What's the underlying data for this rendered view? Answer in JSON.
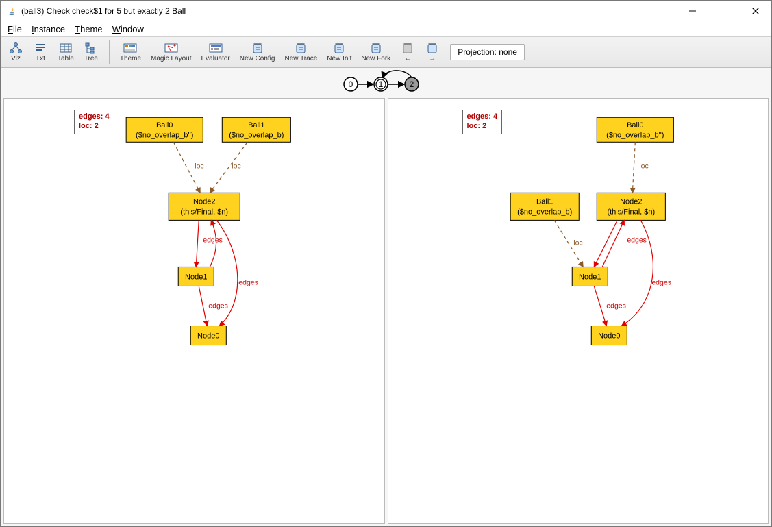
{
  "window": {
    "title": "(ball3) Check check$1 for 5 but exactly 2 Ball"
  },
  "menu": {
    "file": "File",
    "instance": "Instance",
    "theme": "Theme",
    "window": "Window"
  },
  "toolbar": {
    "viz": "Viz",
    "txt": "Txt",
    "table": "Table",
    "tree": "Tree",
    "theme": "Theme",
    "magic_layout": "Magic Layout",
    "evaluator": "Evaluator",
    "new_config": "New Config",
    "new_trace": "New Trace",
    "new_init": "New Init",
    "new_fork": "New Fork",
    "prev": "←",
    "next": "→",
    "projection": "Projection: none"
  },
  "trace": {
    "steps": [
      "0",
      "1",
      "2"
    ],
    "active_index": 1,
    "loop_from_index": 2,
    "loop_to_index": 1
  },
  "panels": [
    {
      "info": {
        "edges": "edges: 4",
        "loc": "loc: 2"
      },
      "nodes": {
        "ball0": {
          "line1": "Ball0",
          "line2": "($no_overlap_b'')"
        },
        "ball1": {
          "line1": "Ball1",
          "line2": "($no_overlap_b)"
        },
        "node2": {
          "line1": "Node2",
          "line2": "(this/Final, $n)"
        },
        "node1": {
          "line1": "Node1"
        },
        "node0": {
          "line1": "Node0"
        }
      },
      "edge_labels": {
        "loc": "loc",
        "edges": "edges"
      }
    },
    {
      "info": {
        "edges": "edges: 4",
        "loc": "loc: 2"
      },
      "nodes": {
        "ball0": {
          "line1": "Ball0",
          "line2": "($no_overlap_b'')"
        },
        "ball1": {
          "line1": "Ball1",
          "line2": "($no_overlap_b)"
        },
        "node2": {
          "line1": "Node2",
          "line2": "(this/Final, $n)"
        },
        "node1": {
          "line1": "Node1"
        },
        "node0": {
          "line1": "Node0"
        }
      },
      "edge_labels": {
        "loc": "loc",
        "edges": "edges"
      }
    }
  ]
}
